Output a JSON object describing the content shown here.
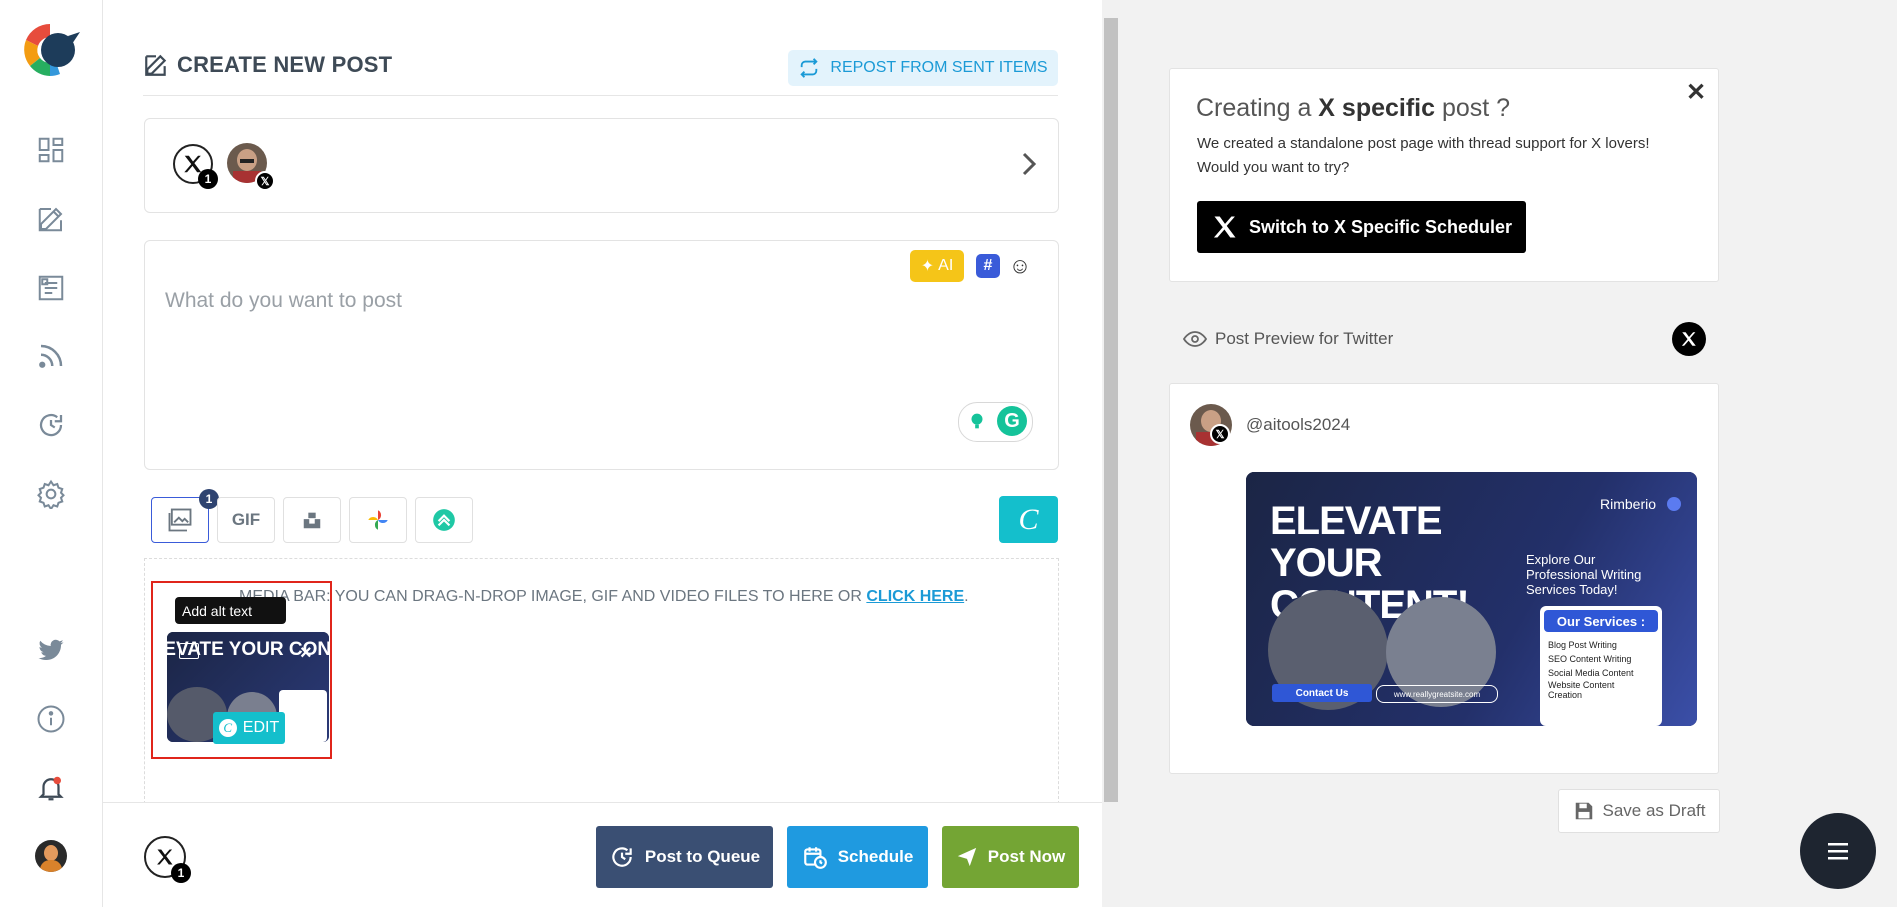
{
  "sidebar": {
    "items": [
      {
        "name": "dashboard-icon"
      },
      {
        "name": "compose-icon"
      },
      {
        "name": "posts-icon"
      },
      {
        "name": "rss-icon"
      },
      {
        "name": "queue-history-icon"
      },
      {
        "name": "settings-icon"
      },
      {
        "name": "twitter-icon"
      },
      {
        "name": "info-icon"
      },
      {
        "name": "notification-bell-icon"
      }
    ]
  },
  "header": {
    "title": "CREATE NEW POST",
    "repost_label": "REPOST FROM SENT ITEMS"
  },
  "accounts": {
    "x_count": "1"
  },
  "editor": {
    "placeholder": "What do you want to post",
    "ai_label": "AI",
    "hash_label": "#"
  },
  "media_tools": {
    "image_count": "1",
    "gif_label": "GIF"
  },
  "media_bar": {
    "text": "MEDIA BAR: YOU CAN DRAG-N-DROP IMAGE, GIF AND VIDEO FILES TO HERE OR ",
    "link": "CLICK HERE",
    "suffix": "."
  },
  "thumbnail": {
    "alt_tooltip": "Add alt text",
    "edit_label": "EDIT",
    "image_text": "ELEVATE YOUR CONTENT!"
  },
  "footer": {
    "x_count": "1",
    "queue_label": "Post to Queue",
    "schedule_label": "Schedule",
    "post_now_label": "Post Now"
  },
  "x_promo": {
    "title_pre": "Creating a ",
    "title_bold": "X specific",
    "title_post": " post ?",
    "description": "We created a standalone post page with thread support for X lovers! Would you want to try?",
    "button_label": "Switch to X Specific Scheduler"
  },
  "preview": {
    "label": "Post Preview for Twitter",
    "handle": "@aitools2024",
    "image": {
      "headline": "ELEVATE YOUR CONTENT!",
      "brand": "Rimberio",
      "subtext": "Explore Our Professional Writing Services Today!",
      "services_title": "Our Services :",
      "services": [
        "Blog Post Writing",
        "SEO Content Writing",
        "Social Media Content",
        "Website Content Creation"
      ],
      "contact": "Contact Us",
      "url": "www.reallygreatsite.com"
    }
  },
  "draft_label": "Save as Draft",
  "colors": {
    "accent_blue": "#1b9ad6",
    "queue_btn": "#3a4f73",
    "schedule_btn": "#1f9ae0",
    "post_now_btn": "#74a534",
    "canva": "#14bfcc",
    "highlight_red": "#e0251b"
  }
}
